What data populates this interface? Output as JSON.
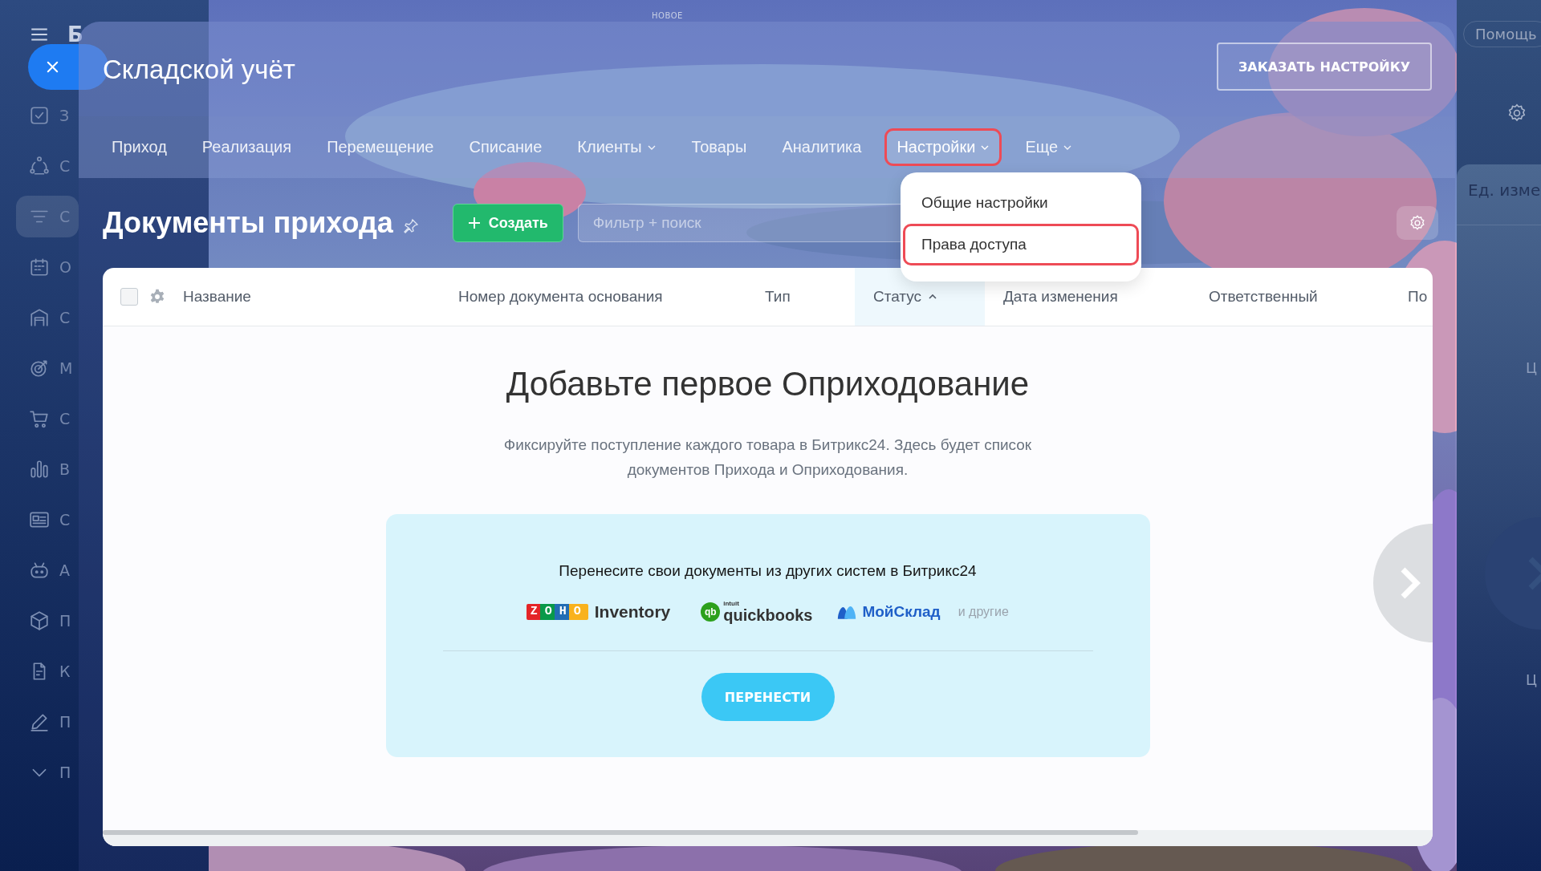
{
  "sidebar": {
    "brand": "Б",
    "items": [
      {
        "kind": "check",
        "label": "З",
        "selected": false
      },
      {
        "kind": "network",
        "label": "С",
        "selected": false
      },
      {
        "kind": "filter",
        "label": "С",
        "selected": true
      },
      {
        "kind": "calendar",
        "label": "О",
        "selected": false
      },
      {
        "kind": "warehouse",
        "label": "С",
        "selected": false
      },
      {
        "kind": "target",
        "label": "М",
        "selected": false
      },
      {
        "kind": "cart",
        "label": "С",
        "selected": false
      },
      {
        "kind": "chart",
        "label": "В",
        "selected": false
      },
      {
        "kind": "card",
        "label": "С",
        "selected": false
      },
      {
        "kind": "robot",
        "label": "А",
        "selected": false
      },
      {
        "kind": "cube",
        "label": "П",
        "selected": false
      },
      {
        "kind": "document",
        "label": "К",
        "selected": false
      },
      {
        "kind": "pencil",
        "label": "П",
        "selected": false
      },
      {
        "kind": "chevron",
        "label": "П",
        "selected": false
      }
    ]
  },
  "top_badge": "НОВОЕ",
  "right_panel": {
    "help": "Помощь",
    "column": "Ед. изме",
    "cells": [
      "Ц",
      "Ц"
    ]
  },
  "slider": {
    "title": "Складской учёт",
    "order_button": "ЗАКАЗАТЬ НАСТРОЙКУ",
    "nav": [
      {
        "label": "Приход",
        "has_menu": false,
        "selected": false,
        "highlighted": false
      },
      {
        "label": "Реализация",
        "has_menu": false,
        "selected": false,
        "highlighted": false
      },
      {
        "label": "Перемещение",
        "has_menu": false,
        "selected": false,
        "highlighted": false
      },
      {
        "label": "Списание",
        "has_menu": false,
        "selected": false,
        "highlighted": false
      },
      {
        "label": "Клиенты",
        "has_menu": true,
        "selected": false,
        "highlighted": false
      },
      {
        "label": "Товары",
        "has_menu": false,
        "selected": false,
        "highlighted": false
      },
      {
        "label": "Аналитика",
        "has_menu": false,
        "selected": false,
        "highlighted": false
      },
      {
        "label": "Настройки",
        "has_menu": true,
        "selected": true,
        "highlighted": true
      },
      {
        "label": "Еще",
        "has_menu": true,
        "selected": false,
        "highlighted": false
      }
    ],
    "menu": [
      {
        "label": "Общие настройки",
        "highlighted": false
      },
      {
        "label": "Права доступа",
        "highlighted": true
      }
    ]
  },
  "page": {
    "title": "Документы прихода",
    "create_button": "Создать",
    "filter": {
      "placeholder": "Фильтр + поиск"
    }
  },
  "table": {
    "select_all": {
      "checked": false
    },
    "columns": [
      {
        "label": "Название",
        "sorted": false
      },
      {
        "label": "Номер документа основания",
        "sorted": false
      },
      {
        "label": "Тип",
        "sorted": false
      },
      {
        "label": "Статус",
        "sorted": true
      },
      {
        "label": "Дата изменения",
        "sorted": false
      },
      {
        "label": "Ответственный",
        "sorted": false
      },
      {
        "label": "По",
        "sorted": false
      }
    ]
  },
  "empty": {
    "title": "Добавьте первое Оприходование",
    "text": "Фиксируйте поступление каждого товара в Битрикс24. Здесь будет список документов Прихода и Оприходования.",
    "import": {
      "text": "Перенесите свои документы из других систем в Битрикс24",
      "systems": [
        {
          "kind": "zoho",
          "mark": "ZOHO",
          "name": "Inventory"
        },
        {
          "kind": "quickbooks",
          "mark": "qb",
          "sub": "intuit",
          "name": "quickbooks"
        },
        {
          "kind": "moysklad",
          "name": "МойСклад"
        }
      ],
      "others": "и другие",
      "button": "ПЕРЕНЕСТИ"
    }
  }
}
